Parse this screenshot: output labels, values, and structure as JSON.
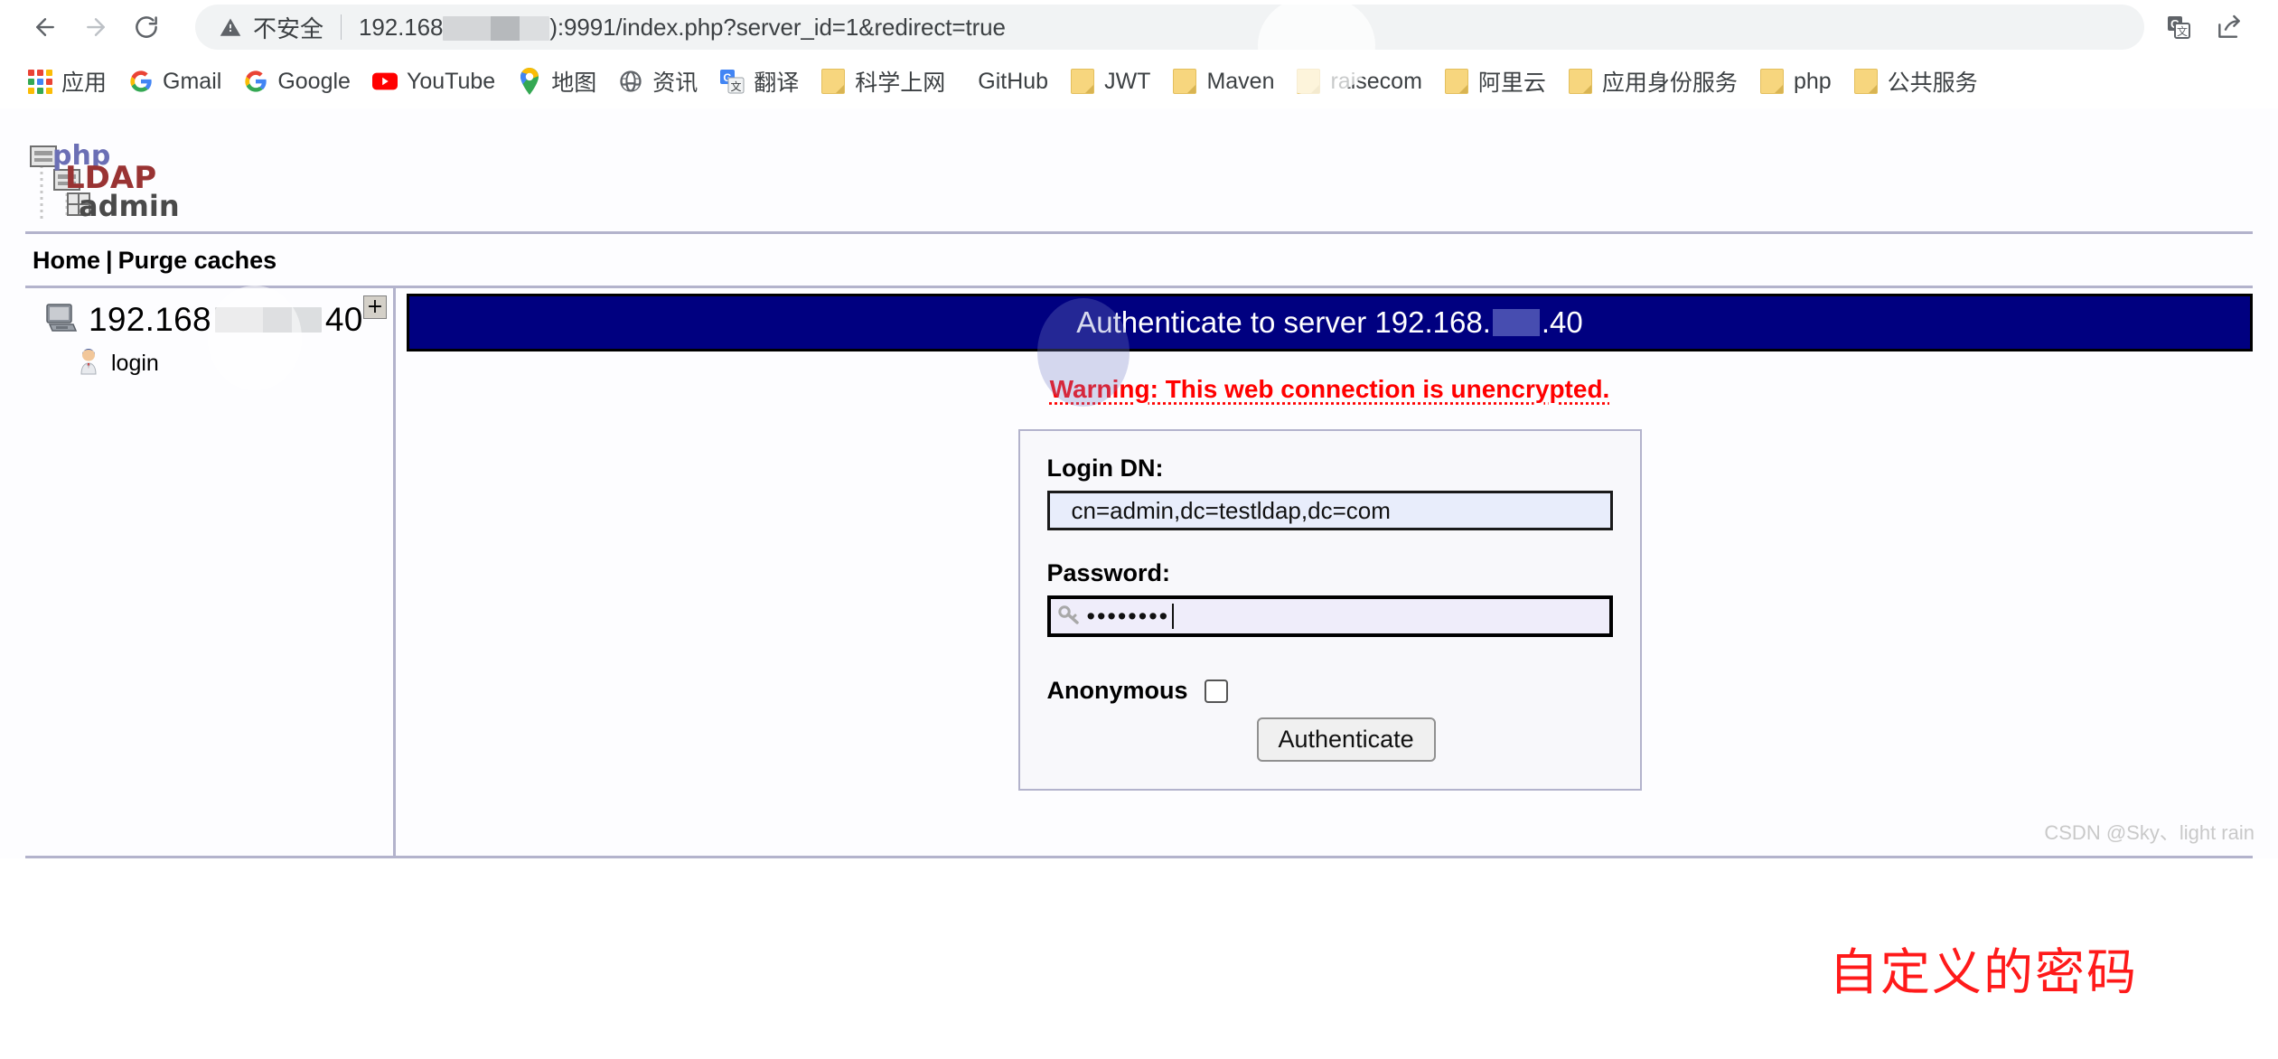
{
  "browser": {
    "nav": {
      "back_icon": "arrow-left-icon",
      "forward_icon": "arrow-right-icon",
      "reload_icon": "reload-icon"
    },
    "omnibox": {
      "security_icon": "warning-triangle-icon",
      "security_label": "不安全",
      "url_prefix": "192.168",
      "url_suffix": "):9991/index.php?server_id=1&redirect=true",
      "full_url": "192.168.x.x:9991/index.php?server_id=1&redirect=true"
    },
    "right_icons": [
      {
        "name": "google-translate-icon",
        "label": "翻译"
      },
      {
        "name": "share-icon",
        "label": "分享"
      }
    ],
    "bookmarks": [
      {
        "label": "应用",
        "icon": "apps-grid-icon"
      },
      {
        "label": "Gmail",
        "icon": "google-g-icon"
      },
      {
        "label": "Google",
        "icon": "google-g-icon"
      },
      {
        "label": "YouTube",
        "icon": "youtube-icon"
      },
      {
        "label": "地图",
        "icon": "google-maps-pin-icon"
      },
      {
        "label": "资讯",
        "icon": "globe-news-icon"
      },
      {
        "label": "翻译",
        "icon": "google-translate-icon"
      },
      {
        "label": "科学上网",
        "icon": "folder-icon"
      },
      {
        "label": "GitHub",
        "icon": "none"
      },
      {
        "label": "JWT",
        "icon": "folder-icon"
      },
      {
        "label": "Maven",
        "icon": "folder-icon"
      },
      {
        "label": "raisecom",
        "icon": "folder-icon"
      },
      {
        "label": "阿里云",
        "icon": "folder-icon"
      },
      {
        "label": "应用身份服务",
        "icon": "folder-icon"
      },
      {
        "label": "php",
        "icon": "folder-icon"
      },
      {
        "label": "公共服务",
        "icon": "folder-icon"
      }
    ]
  },
  "app": {
    "logo_alt": "phpLDAPadmin",
    "logo_text": {
      "php": "php",
      "ldap": "LDAP",
      "admin": "admin"
    },
    "topmenu": {
      "home": "Home",
      "separator": "|",
      "purge": "Purge caches"
    },
    "sidebar": {
      "expand_icon": "plus-box-icon",
      "server_icon": "server-computer-icon",
      "server_prefix": "192.168",
      "server_suffix": "40",
      "login_icon": "user-login-icon",
      "login_label": "login"
    },
    "main": {
      "banner_prefix": "Authenticate to server 192.168.",
      "banner_suffix": ".40",
      "warning": "Warning: This web connection is unencrypted.",
      "form": {
        "login_dn_label": "Login DN:",
        "login_dn_value": "cn=admin,dc=testldap,dc=com",
        "password_label": "Password:",
        "password_masked": "••••••••",
        "password_icon": "key-icon",
        "anonymous_label": "Anonymous",
        "anonymous_checked": false,
        "authenticate_label": "Authenticate"
      }
    },
    "annotation": "自定义的密码"
  },
  "watermark": "CSDN @Sky、light rain",
  "colors": {
    "banner_bg": "#000080",
    "warning_red": "#ff0000",
    "annotation_red": "#ff1a1a",
    "frame_rule": "#b3b3cc",
    "input_bg": "#e8edfb"
  }
}
